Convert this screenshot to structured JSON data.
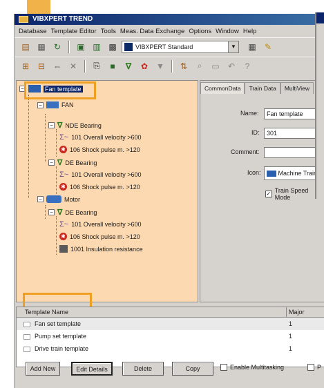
{
  "window": {
    "title": "VIBXPERT TREND"
  },
  "menu": [
    "Database",
    "Template Editor",
    "Tools",
    "Meas. Data Exchange",
    "Options",
    "Window",
    "Help"
  ],
  "toolbar": {
    "combo_value": "VIBXPERT Standard"
  },
  "tree": {
    "root": "Fan template",
    "fan": "FAN",
    "nde": "NDE Bearing",
    "nde_m1": "101 Overall velocity >600",
    "nde_m2": "106 Shock pulse m. >120",
    "de1": "DE Bearing",
    "de1_m1": "101 Overall velocity >600",
    "de1_m2": "106 Shock pulse m. >120",
    "motor": "Motor",
    "de2": "DE Bearing",
    "de2_m1": "101 Overall velocity >600",
    "de2_m2": "106 Shock pulse m. >120",
    "de2_m3": "1001 Insulation resistance"
  },
  "tabs": [
    "CommonData",
    "Train Data",
    "MultiView"
  ],
  "form": {
    "name_label": "Name:",
    "name_value": "Fan template",
    "id_label": "ID:",
    "id_value": "301",
    "comment_label": "Comment:",
    "comment_value": "",
    "icon_label": "Icon:",
    "icon_value": "Machine Train",
    "train_speed_label": "Train Speed Mode"
  },
  "list": {
    "col_name": "Template Name",
    "col_version": "Major Version",
    "rows": [
      {
        "name": "Fan set template",
        "version": "1"
      },
      {
        "name": "Pump set template",
        "version": "1"
      },
      {
        "name": "Drive train template",
        "version": "1"
      }
    ]
  },
  "buttons": {
    "add_new": "Add New",
    "edit_details": "Edit Details",
    "delete": "Delete",
    "copy": "Copy",
    "enable_multitasking": "Enable Multitasking",
    "p_label": "P"
  },
  "colors": {
    "tree_bg": "#fcd9b0",
    "highlight": "#f0a020",
    "titlebar": "#0b246a"
  }
}
